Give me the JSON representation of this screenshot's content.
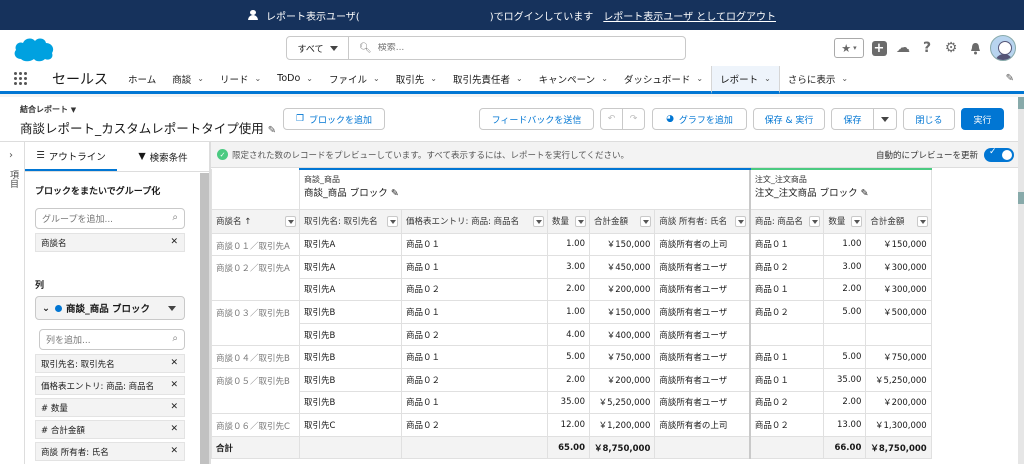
{
  "banner": {
    "prefix": "レポート表示ユーザ(",
    "suffix": ")でログインしています",
    "logout": "レポート表示ユーザ としてログアウト"
  },
  "search": {
    "scope": "すべて",
    "placeholder": "検索..."
  },
  "app": {
    "name": "セールス"
  },
  "nav": {
    "tabs": [
      {
        "label": "ホーム",
        "chevron": false
      },
      {
        "label": "商談",
        "chevron": true
      },
      {
        "label": "リード",
        "chevron": true
      },
      {
        "label": "ToDo",
        "chevron": true
      },
      {
        "label": "ファイル",
        "chevron": true
      },
      {
        "label": "取引先",
        "chevron": true
      },
      {
        "label": "取引先責任者",
        "chevron": true
      },
      {
        "label": "キャンペーン",
        "chevron": true
      },
      {
        "label": "ダッシュボード",
        "chevron": true
      },
      {
        "label": "レポート",
        "chevron": true
      },
      {
        "label": "さらに表示",
        "chevron": true
      }
    ],
    "active": "レポート"
  },
  "report": {
    "type_label": "結合レポート",
    "title": "商談レポート_カスタムレポートタイプ使用",
    "buttons": {
      "add_block": "ブロックを追加",
      "feedback": "フィードバックを送信",
      "add_chart": "グラフを追加",
      "save_run": "保存 & 実行",
      "save": "保存",
      "close": "閉じる",
      "run": "実行"
    }
  },
  "sidebar": {
    "strip_label": "項目",
    "tab_outline": "アウトライン",
    "tab_filters": "検索条件",
    "group_section": "ブロックをまたいでグループ化",
    "group_placeholder": "グループを追加...",
    "group_items": [
      "商談名"
    ],
    "columns_section": "列",
    "block_name": "商談_商品 ブロック",
    "column_placeholder": "列を追加...",
    "columns": [
      "取引先名: 取引先名",
      "価格表エントリ: 商品: 商品名",
      "# 数量",
      "# 合計金額",
      "商談 所有者: 氏名"
    ]
  },
  "preview": {
    "notice": "限定された数のレコードをプレビューしています。すべて表示するには、レポートを実行してください。",
    "auto_update": "自動的にプレビューを更新"
  },
  "table": {
    "block1": {
      "type": "商談_商品",
      "name": "商談_商品 ブロック"
    },
    "block2": {
      "type": "注文_注文商品",
      "name": "注文_注文商品 ブロック"
    },
    "group_header": "商談名 ↑",
    "block1_headers": [
      "取引先名: 取引先名",
      "価格表エントリ: 商品: 商品名",
      "数量",
      "合計金額",
      "商談 所有者: 氏名"
    ],
    "block2_headers": [
      "商品: 商品名",
      "数量",
      "合計金額"
    ],
    "groups": [
      {
        "name": "商談０１／取引先A",
        "rows": [
          {
            "b1": [
              "取引先A",
              "商品０１",
              "1.00",
              "￥150,000",
              "商談所有者の上司"
            ],
            "b2": [
              "商品０１",
              "1.00",
              "￥150,000"
            ]
          }
        ]
      },
      {
        "name": "商談０２／取引先A",
        "rows": [
          {
            "b1": [
              "取引先A",
              "商品０１",
              "3.00",
              "￥450,000",
              "商談所有者ユーザ"
            ],
            "b2": [
              "商品０２",
              "3.00",
              "￥300,000"
            ]
          },
          {
            "b1": [
              "取引先A",
              "商品０２",
              "2.00",
              "￥200,000",
              "商談所有者ユーザ"
            ],
            "b2": [
              "商品０１",
              "2.00",
              "￥300,000"
            ]
          }
        ]
      },
      {
        "name": "商談０３／取引先B",
        "rows": [
          {
            "b1": [
              "取引先B",
              "商品０１",
              "1.00",
              "￥150,000",
              "商談所有者ユーザ"
            ],
            "b2": [
              "商品０２",
              "5.00",
              "￥500,000"
            ]
          },
          {
            "b1": [
              "取引先B",
              "商品０２",
              "4.00",
              "￥400,000",
              "商談所有者ユーザ"
            ],
            "b2": [
              "",
              "",
              ""
            ]
          }
        ]
      },
      {
        "name": "商談０４／取引先B",
        "rows": [
          {
            "b1": [
              "取引先B",
              "商品０１",
              "5.00",
              "￥750,000",
              "商談所有者ユーザ"
            ],
            "b2": [
              "商品０１",
              "5.00",
              "￥750,000"
            ]
          }
        ]
      },
      {
        "name": "商談０５／取引先B",
        "rows": [
          {
            "b1": [
              "取引先B",
              "商品０２",
              "2.00",
              "￥200,000",
              "商談所有者ユーザ"
            ],
            "b2": [
              "商品０１",
              "35.00",
              "￥5,250,000"
            ]
          },
          {
            "b1": [
              "取引先B",
              "商品０１",
              "35.00",
              "￥5,250,000",
              "商談所有者ユーザ"
            ],
            "b2": [
              "商品０２",
              "2.00",
              "￥200,000"
            ]
          }
        ]
      },
      {
        "name": "商談０６／取引先C",
        "rows": [
          {
            "b1": [
              "取引先C",
              "商品０２",
              "12.00",
              "￥1,200,000",
              "商談所有者の上司"
            ],
            "b2": [
              "商品０２",
              "13.00",
              "￥1,300,000"
            ]
          }
        ]
      }
    ],
    "total": {
      "label": "合計",
      "b1_qty": "65.00",
      "b1_amount": "￥8,750,000",
      "b2_qty": "66.00",
      "b2_amount": "￥8,750,000"
    }
  }
}
